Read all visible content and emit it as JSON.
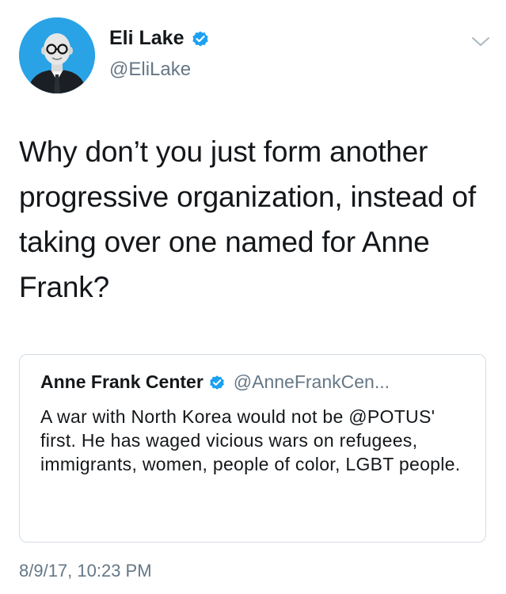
{
  "author": {
    "display_name": "Eli Lake",
    "handle": "@EliLake",
    "verified": true
  },
  "tweet": {
    "text": "Why don’t you just form another progressive organization, instead of taking over one named for Anne Frank?",
    "timestamp": "8/9/17, 10:23 PM"
  },
  "quoted_tweet": {
    "display_name": "Anne Frank Center",
    "handle": "@AnneFrankCen...",
    "verified": true,
    "text": "A war with North Korea would not be @POTUS' first. He has waged vicious wars on refugees, immigrants, women, people of color, LGBT people."
  },
  "icons": {
    "avatar": "profile-photo",
    "verified": "verified-badge-icon",
    "menu": "chevron-down-icon"
  },
  "colors": {
    "verified_blue": "#1da1f2",
    "secondary_text": "#657786",
    "primary_text": "#14171a",
    "avatar_bg": "#2aa3e6"
  }
}
